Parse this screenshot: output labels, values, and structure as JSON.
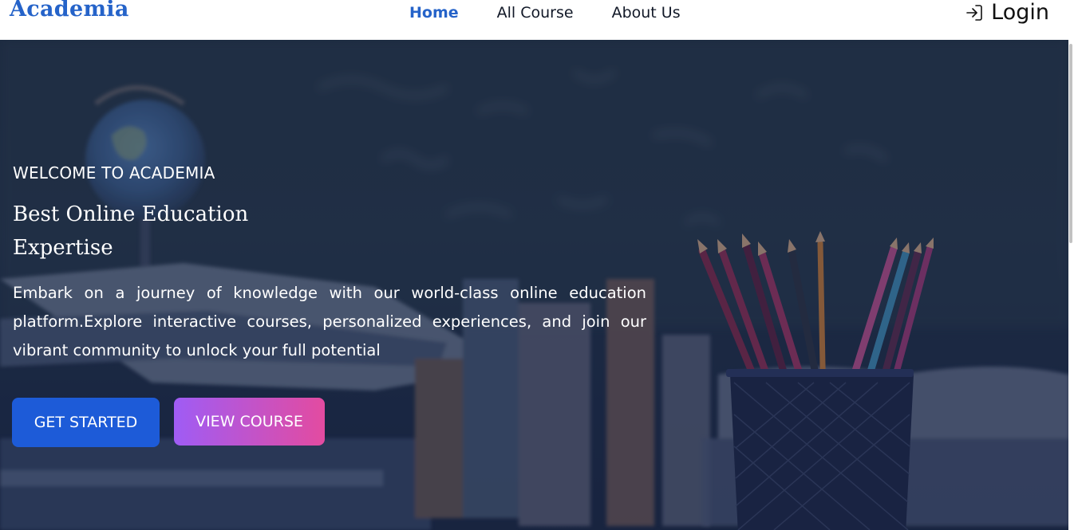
{
  "brand": {
    "name": "Academia",
    "color": "#2563c9"
  },
  "nav": {
    "links": [
      {
        "label": "Home",
        "active": true
      },
      {
        "label": "All Course",
        "active": false
      },
      {
        "label": "About Us",
        "active": false
      }
    ],
    "login_label": "Login",
    "login_icon": "login-arrow-icon"
  },
  "hero": {
    "eyebrow": "WELCOME TO ACADEMIA",
    "headline": "Best Online Education Expertise",
    "description": "Embark on a journey of knowledge with our world-class online education platform.Explore interactive courses, personalized experiences, and join our vibrant community to unlock your full potential",
    "buttons": {
      "primary": "GET STARTED",
      "secondary": "VIEW COURSE"
    },
    "colors": {
      "primary_button": "#1d5bd8",
      "secondary_gradient_start": "#9f5cf5",
      "secondary_gradient_end": "#e34ba0",
      "overlay": "#1b2843"
    }
  }
}
